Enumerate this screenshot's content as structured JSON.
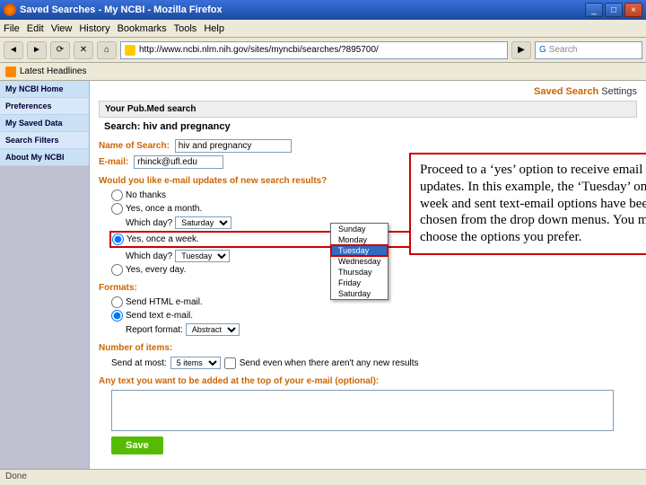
{
  "window": {
    "title": "Saved Searches - My NCBI - Mozilla Firefox"
  },
  "menu": [
    "File",
    "Edit",
    "View",
    "History",
    "Bookmarks",
    "Tools",
    "Help"
  ],
  "url": "http://www.ncbi.nlm.nih.gov/sites/myncbi/searches/?895700/",
  "search_placeholder": "Search",
  "bookmark_bar": {
    "latest": "Latest Headlines"
  },
  "sidebar": {
    "items": [
      {
        "label": "My NCBI Home"
      },
      {
        "label": "Preferences"
      },
      {
        "label": "My Saved Data"
      },
      {
        "label": "Search Filters"
      },
      {
        "label": "About My NCBI"
      }
    ]
  },
  "settings": {
    "heading_bold": "Saved Search",
    "heading_rest": " Settings",
    "pubmed_label": "Your Pub.Med search",
    "search_label": "Search:",
    "search_query": "hiv and pregnancy",
    "name_label": "Name of Search:",
    "name_value": "hiv and pregnancy",
    "email_label": "E-mail:",
    "email_value": "rhinck@ufl.edu",
    "question": "Would you like e-mail updates of new search results?",
    "radios": {
      "no": "No thanks",
      "month": "Yes, once a month.",
      "month_day_label": "Which day?",
      "month_day_value": "Saturday",
      "week": "Yes, once a week.",
      "week_day_label": "Which day?",
      "week_day_value": "Tuesday",
      "daily": "Yes, every day."
    },
    "days": [
      "Sunday",
      "Monday",
      "Tuesday",
      "Wednesday",
      "Thursday",
      "Friday",
      "Saturday"
    ],
    "formats_label": "Formats:",
    "format_html": "Send HTML e-mail.",
    "format_text": "Send text e-mail.",
    "report_label": "Report format:",
    "report_value": "Abstract",
    "numitems_label": "Number of items:",
    "send_at_most": "Send at most:",
    "send_count": "5 items",
    "send_even": "Send even when there aren't any new results",
    "anytext_label": "Any text you want to be added at the top of your e-mail (optional):",
    "save": "Save"
  },
  "callout": "Proceed to a ‘yes’ option to receive email updates.  In this example, the ‘Tuesday’ once a week and sent text-email options have been chosen from the drop down menus.  You may choose the options you prefer.",
  "status": "Done"
}
